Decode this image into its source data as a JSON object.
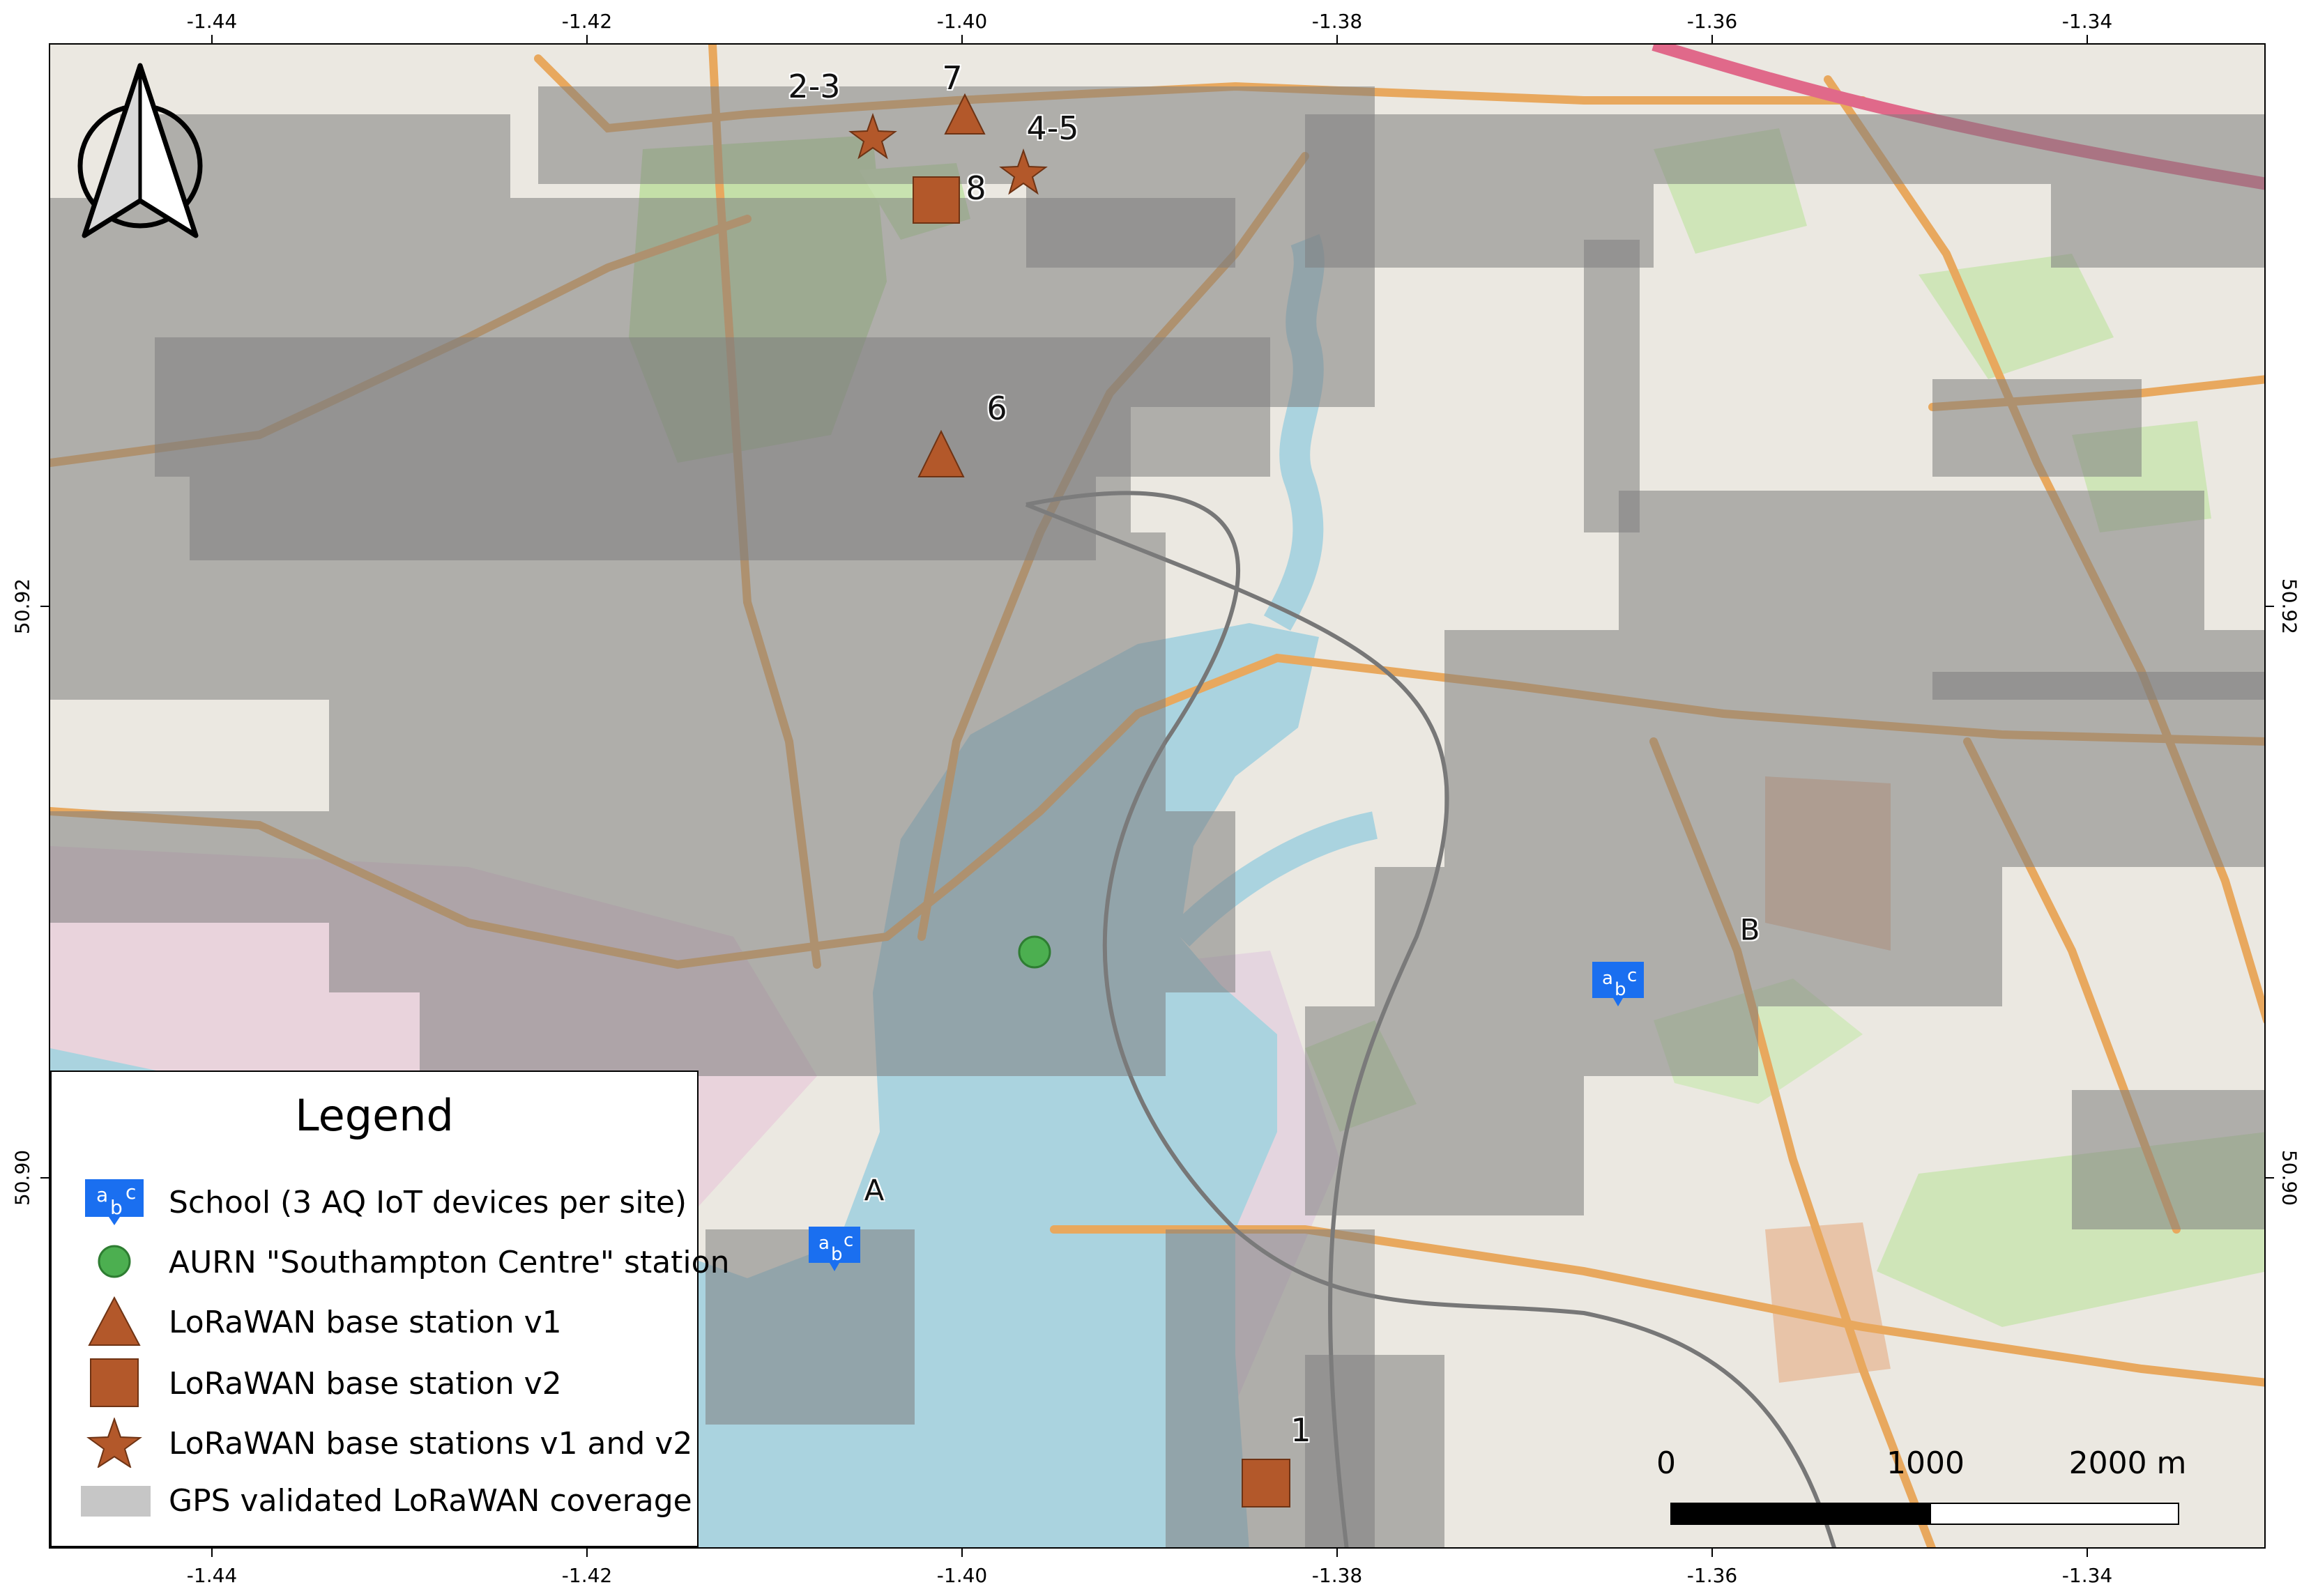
{
  "axes": {
    "top_ticks": [
      "-1.44",
      "-1.42",
      "-1.40",
      "-1.38",
      "-1.36",
      "-1.34"
    ],
    "bottom_ticks": [
      "-1.44",
      "-1.42",
      "-1.40",
      "-1.38",
      "-1.36",
      "-1.34"
    ],
    "left_ticks": [
      "50.92",
      "50.90"
    ],
    "right_ticks": [
      "50.92",
      "50.90"
    ]
  },
  "sites": [
    {
      "label": "2-3",
      "symbol": "star"
    },
    {
      "label": "7",
      "symbol": "triangle"
    },
    {
      "label": "4-5",
      "symbol": "star"
    },
    {
      "label": "8",
      "symbol": "square"
    },
    {
      "label": "6",
      "symbol": "triangle"
    },
    {
      "label": "1",
      "symbol": "square"
    }
  ],
  "schools": [
    {
      "label": "A"
    },
    {
      "label": "B"
    }
  ],
  "school_icon_text": {
    "a": "a",
    "b": "b",
    "c": "c"
  },
  "legend": {
    "title": "Legend",
    "items": [
      {
        "label": "School (3 AQ IoT devices per site)",
        "symbol": "school-icon"
      },
      {
        "label": "AURN \"Southampton Centre\" station",
        "symbol": "green-circle"
      },
      {
        "label": "LoRaWAN base station v1",
        "symbol": "triangle"
      },
      {
        "label": "LoRaWAN base station v2",
        "symbol": "square"
      },
      {
        "label": "LoRaWAN base stations v1 and v2",
        "symbol": "star"
      },
      {
        "label": "GPS validated LoRaWAN coverage",
        "symbol": "grey-box"
      }
    ]
  },
  "scale_bar": {
    "labels": [
      "0",
      "1000",
      "2000 m"
    ]
  },
  "colors": {
    "station_fill": "#b3582a",
    "station_stroke": "#6e3314",
    "aurn_fill": "#4caf50",
    "school_blue": "#1a6ff0",
    "coverage_grey": "#8a8a8a",
    "water": "#aad3df",
    "land": "#f1ede4",
    "roads": "#e8a85e"
  }
}
